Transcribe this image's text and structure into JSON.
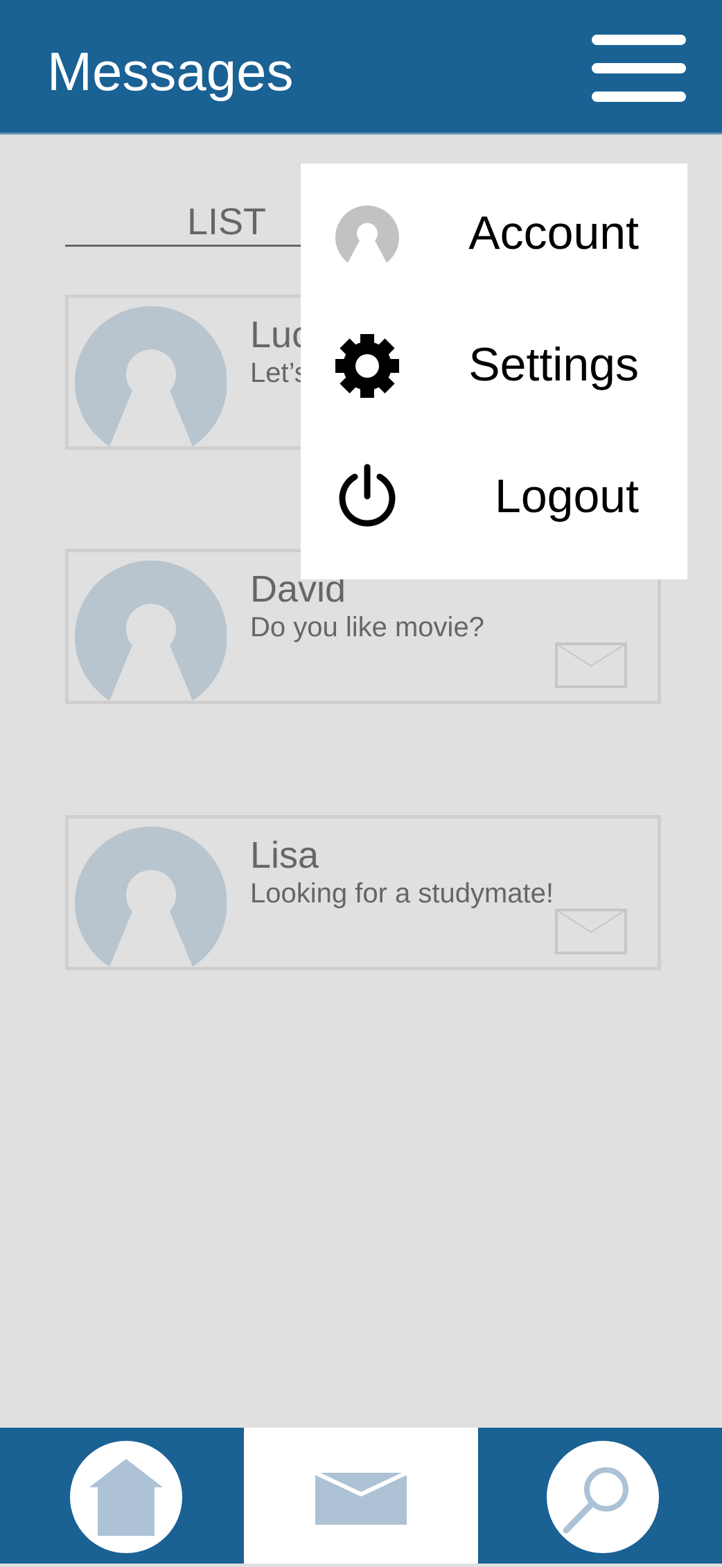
{
  "header": {
    "title": "Messages",
    "menu_icon": "hamburger-menu-icon"
  },
  "tabs": {
    "active_label": "LIST"
  },
  "conversations": [
    {
      "name": "Luc",
      "preview": "Let’s",
      "avatar_icon": "user-avatar-icon",
      "mail_icon": "envelope-icon"
    },
    {
      "name": "David",
      "preview": "Do you like movie?",
      "avatar_icon": "user-avatar-icon",
      "mail_icon": "envelope-icon"
    },
    {
      "name": "Lisa",
      "preview": "Looking for a studymate!",
      "avatar_icon": "user-avatar-icon",
      "mail_icon": "envelope-icon"
    }
  ],
  "dropdown_menu": {
    "items": [
      {
        "label": "Account",
        "icon": "account-icon"
      },
      {
        "label": "Settings",
        "icon": "gear-icon"
      },
      {
        "label": "Logout",
        "icon": "power-icon"
      }
    ]
  },
  "bottom_nav": {
    "items": [
      {
        "id": "home",
        "icon": "home-icon",
        "active": false
      },
      {
        "id": "messages",
        "icon": "envelope-icon",
        "active": true
      },
      {
        "id": "search",
        "icon": "search-icon",
        "active": false
      }
    ]
  },
  "colors": {
    "header_bg": "#1a6194",
    "page_bg": "#e0e0e0",
    "avatar": "#b8c4ce",
    "muted_text": "#666666",
    "card_border": "#cfcfcf",
    "nav_icon": "#adc2d4"
  }
}
